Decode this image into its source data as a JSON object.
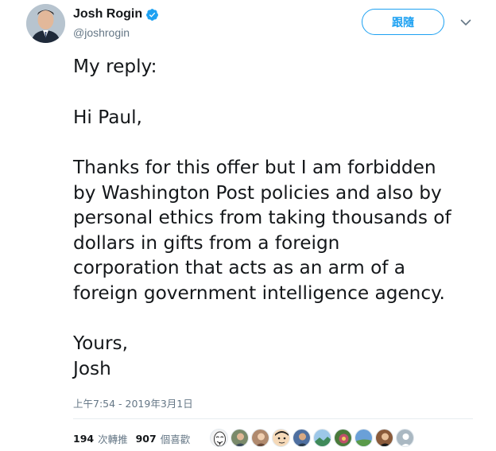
{
  "tweet": {
    "author": {
      "display_name": "Josh Rogin",
      "handle": "@joshrogin",
      "verified": true,
      "avatar_icon": "profile-photo-avatar"
    },
    "follow_label": "跟隨",
    "menu_icon": "chevron-down-icon",
    "paragraphs": [
      [
        "My reply:"
      ],
      [
        "Hi Paul,"
      ],
      [
        "Thanks for this offer but I am forbidden",
        "by Washington Post policies and also by",
        "personal ethics from taking thousands of",
        "dollars in gifts from a foreign",
        "corporation that acts as an arm of a",
        "foreign government intelligence agency."
      ],
      [
        "Yours,",
        "Josh"
      ]
    ],
    "timestamp": "上午7:54 - 2019年3月1日",
    "stats": {
      "retweets_count": "194",
      "retweets_label": "次轉推",
      "likes_count": "907",
      "likes_label": "個喜歡"
    },
    "likers": [
      {
        "icon": "anonymous-mask-avatar",
        "color": "#f2f2f2"
      },
      {
        "icon": "person-avatar",
        "color": "#7a8a6a"
      },
      {
        "icon": "person-avatar",
        "color": "#b08a6e"
      },
      {
        "icon": "cartoon-face-avatar",
        "color": "#f5d9b8"
      },
      {
        "icon": "person-avatar",
        "color": "#4e6fa0"
      },
      {
        "icon": "landscape-avatar",
        "color": "#3f8a5a"
      },
      {
        "icon": "flower-avatar",
        "color": "#c0506a"
      },
      {
        "icon": "landscape-avatar",
        "color": "#6aa0d8"
      },
      {
        "icon": "person-avatar",
        "color": "#8a5a3a"
      },
      {
        "icon": "default-avatar",
        "color": "#aab8c2"
      }
    ],
    "colors": {
      "accent": "#1da1f2",
      "text": "#14171a",
      "muted": "#657786",
      "divider": "#e6ecf0"
    }
  }
}
